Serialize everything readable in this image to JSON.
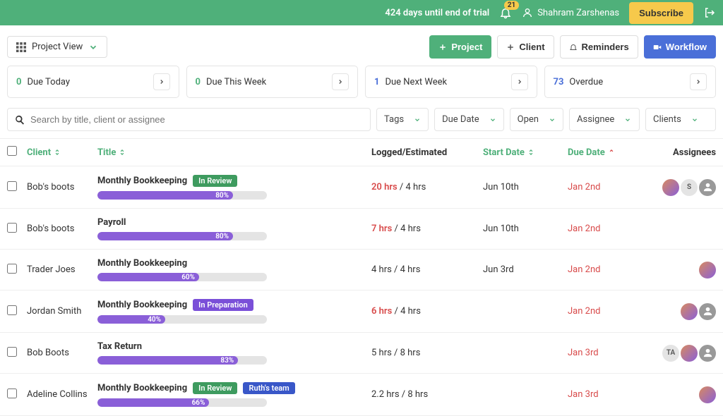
{
  "topbar": {
    "trial": "424 days until end of trial",
    "notif_count": "21",
    "user_name": "Shahram Zarshenas",
    "subscribe": "Subscribe"
  },
  "toolbar": {
    "project_view": "Project View",
    "buttons": {
      "project": "Project",
      "client": "Client",
      "reminders": "Reminders",
      "workflow": "Workflow"
    }
  },
  "stats": [
    {
      "count": "0",
      "label": "Due Today",
      "class": "green"
    },
    {
      "count": "0",
      "label": "Due This Week",
      "class": "green"
    },
    {
      "count": "1",
      "label": "Due Next Week",
      "class": "blue"
    },
    {
      "count": "73",
      "label": "Overdue",
      "class": "blue"
    }
  ],
  "filters": {
    "search_placeholder": "Search by title, client or assignee",
    "tags": "Tags",
    "due_date": "Due Date",
    "open": "Open",
    "assignee": "Assignee",
    "clients": "Clients"
  },
  "columns": {
    "client": "Client",
    "title": "Title",
    "logged": "Logged/Estimated",
    "start": "Start Date",
    "due": "Due Date",
    "assignees": "Assignees"
  },
  "rows": [
    {
      "client": "Bob's boots",
      "title": "Monthly Bookkeeping",
      "tags": [
        {
          "label": "In Review",
          "cls": "tag-green"
        }
      ],
      "pct": "80%",
      "pctw": 80,
      "logged": "20 hrs",
      "est": "4 hrs",
      "logged_red": true,
      "start": "Jun 10th",
      "due": "Jan 2nd",
      "avatars": [
        "img1",
        "gray",
        "img2"
      ]
    },
    {
      "client": "Bob's boots",
      "title": "Payroll",
      "tags": [],
      "pct": "80%",
      "pctw": 80,
      "logged": "7 hrs",
      "est": "4 hrs",
      "logged_red": true,
      "start": "Jun 10th",
      "due": "Jan 2nd",
      "avatars": []
    },
    {
      "client": "Trader Joes",
      "title": "Monthly Bookkeeping",
      "tags": [],
      "pct": "60%",
      "pctw": 60,
      "logged": "4 hrs",
      "est": "4 hrs",
      "logged_red": false,
      "start": "Jun 3rd",
      "due": "Jan 2nd",
      "avatars": [
        "img1"
      ]
    },
    {
      "client": "Jordan Smith",
      "title": "Monthly Bookkeeping",
      "tags": [
        {
          "label": "In Preparation",
          "cls": "tag-purple"
        }
      ],
      "pct": "40%",
      "pctw": 40,
      "logged": "6 hrs",
      "est": "4 hrs",
      "logged_red": true,
      "start": "",
      "due": "Jan 2nd",
      "avatars": [
        "img1",
        "img2"
      ]
    },
    {
      "client": "Bob Boots",
      "title": "Tax Return",
      "tags": [],
      "pct": "83%",
      "pctw": 83,
      "logged": "5 hrs",
      "est": "8 hrs",
      "logged_red": false,
      "start": "",
      "due": "Jan 3rd",
      "avatars": [
        "ta",
        "img1",
        "img2"
      ]
    },
    {
      "client": "Adeline Collins",
      "title": "Monthly Bookkeeping",
      "tags": [
        {
          "label": "In Review",
          "cls": "tag-green"
        },
        {
          "label": "Ruth's team",
          "cls": "tag-blue"
        }
      ],
      "pct": "66%",
      "pctw": 66,
      "logged": "2.2 hrs",
      "est": "8 hrs",
      "logged_red": false,
      "start": "",
      "due": "Jan 3rd",
      "avatars": [
        "img1"
      ]
    }
  ]
}
